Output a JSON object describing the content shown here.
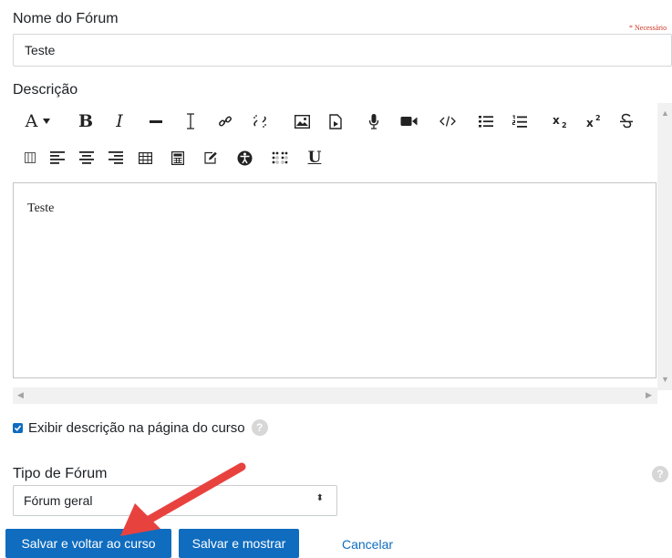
{
  "forum_name": {
    "label": "Nome do Fórum",
    "required_text": "* Necessário",
    "value": "Teste"
  },
  "description": {
    "label": "Descrição",
    "content": "Teste",
    "toolbar_row1": [
      {
        "name": "font-style-menu-icon",
        "glyph": "A"
      },
      {
        "name": "bold-icon",
        "glyph": "B"
      },
      {
        "name": "italic-icon",
        "glyph": "I"
      },
      {
        "name": "horizontal-rule-icon"
      },
      {
        "name": "text-cursor-icon"
      },
      {
        "name": "link-icon"
      },
      {
        "name": "unlink-icon"
      },
      {
        "name": "image-icon"
      },
      {
        "name": "media-file-icon"
      },
      {
        "name": "microphone-icon"
      },
      {
        "name": "video-camera-icon"
      },
      {
        "name": "html-code-icon"
      },
      {
        "name": "bullet-list-icon"
      },
      {
        "name": "numbered-list-icon"
      },
      {
        "name": "subscript-icon"
      },
      {
        "name": "superscript-icon"
      },
      {
        "name": "strikethrough-icon"
      }
    ],
    "toolbar_row2": [
      {
        "name": "toolbar-collapse-icon"
      },
      {
        "name": "align-left-icon"
      },
      {
        "name": "align-center-icon"
      },
      {
        "name": "align-right-icon"
      },
      {
        "name": "table-icon"
      },
      {
        "name": "calculator-icon"
      },
      {
        "name": "edit-note-icon"
      },
      {
        "name": "accessibility-icon"
      },
      {
        "name": "braille-icon"
      },
      {
        "name": "underline-icon",
        "glyph": "U"
      }
    ]
  },
  "show_description": {
    "label": "Exibir descrição na página do curso",
    "checked": true
  },
  "forum_type": {
    "label": "Tipo de Fórum",
    "selected": "Fórum geral"
  },
  "actions": {
    "save_return": "Salvar e voltar ao curso",
    "save_show": "Salvar e mostrar",
    "cancel": "Cancelar"
  },
  "colors": {
    "primary": "#0f6cbf",
    "required": "#ca3120",
    "annotation_arrow": "#e8423f"
  }
}
